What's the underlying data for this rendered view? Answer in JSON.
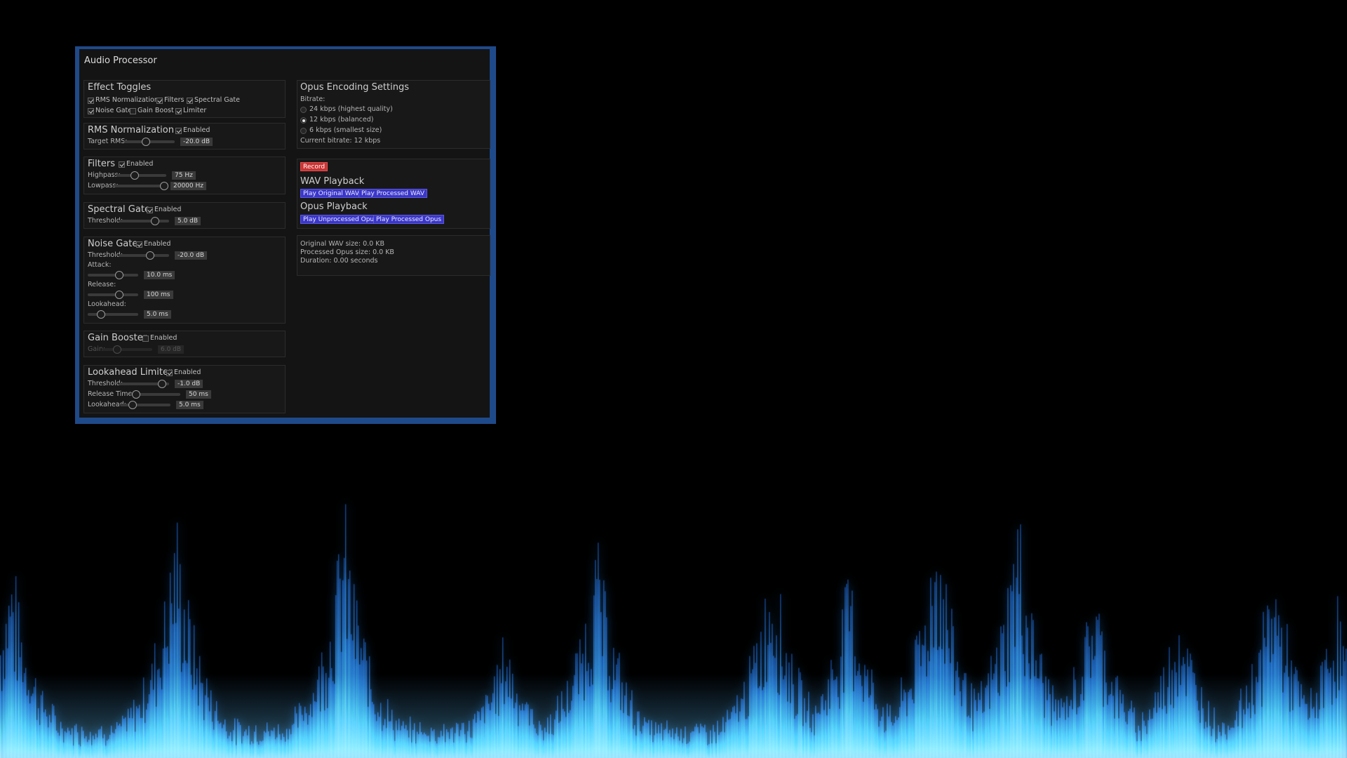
{
  "window": {
    "title": "Audio Processor"
  },
  "effect_toggles": {
    "title": "Effect Toggles",
    "items": [
      {
        "label": "RMS Normalization",
        "checked": true
      },
      {
        "label": "Filters",
        "checked": true
      },
      {
        "label": "Spectral Gate",
        "checked": true
      },
      {
        "label": "Noise Gate",
        "checked": true
      },
      {
        "label": "Gain Boost",
        "checked": false
      },
      {
        "label": "Limiter",
        "checked": true
      }
    ]
  },
  "rms": {
    "title": "RMS Normalization",
    "enabled_label": "Enabled",
    "enabled": true,
    "target_label": "Target RMS:",
    "target_value": "-20.0 dB",
    "target_fraction": 0.43
  },
  "filters": {
    "title": "Filters",
    "enabled_label": "Enabled",
    "enabled": true,
    "highpass_label": "Highpass:",
    "highpass_value": "75 Hz",
    "highpass_fraction": 0.38,
    "lowpass_label": "Lowpass:",
    "lowpass_value": "20000 Hz",
    "lowpass_fraction": 0.98
  },
  "spectral_gate": {
    "title": "Spectral Gate",
    "enabled_label": "Enabled",
    "enabled": true,
    "threshold_label": "Threshold:",
    "threshold_value": "5.0 dB",
    "threshold_fraction": 0.72
  },
  "noise_gate": {
    "title": "Noise Gate",
    "enabled_label": "Enabled",
    "enabled": true,
    "threshold_label": "Threshold:",
    "threshold_value": "-20.0 dB",
    "threshold_fraction": 0.63,
    "attack_label": "Attack:",
    "attack_value": "10.0 ms",
    "attack_fraction": 0.63,
    "release_label": "Release:",
    "release_value": "100 ms",
    "release_fraction": 0.63,
    "lookahead_label": "Lookahead:",
    "lookahead_value": "5.0 ms",
    "lookahead_fraction": 0.27
  },
  "gain_booster": {
    "title": "Gain Booster",
    "enabled_label": "Enabled",
    "enabled": false,
    "gain_label": "Gain:",
    "gain_value": "6.0 dB",
    "gain_fraction": 0.3
  },
  "limiter": {
    "title": "Lookahead Limiter",
    "enabled_label": "Enabled",
    "enabled": true,
    "threshold_label": "Threshold:",
    "threshold_value": "-1.0 dB",
    "threshold_fraction": 0.86,
    "release_label": "Release Time:",
    "release_value": "50 ms",
    "release_fraction": 0.12,
    "lookahead_label": "Lookahead:",
    "lookahead_value": "5.0 ms",
    "lookahead_fraction": 0.25
  },
  "opus": {
    "title": "Opus Encoding Settings",
    "bitrate_label": "Bitrate:",
    "options": [
      {
        "label": "24 kbps (highest quality)",
        "selected": false
      },
      {
        "label": "12 kbps (balanced)",
        "selected": true
      },
      {
        "label": "6 kbps (smallest size)",
        "selected": false
      }
    ],
    "current": "Current bitrate: 12 kbps"
  },
  "playback": {
    "record_label": "Record",
    "wav_title": "WAV Playback",
    "play_original_wav": "Play Original WAV",
    "play_processed_wav": "Play Processed WAV",
    "opus_title": "Opus Playback",
    "play_unprocessed_opus": "Play Unprocessed Opus",
    "play_processed_opus": "Play Processed Opus"
  },
  "info": {
    "wav_size": "Original WAV size: 0.0 KB",
    "opus_size": "Processed Opus size: 0.0 KB",
    "duration": "Duration: 0.00 seconds"
  },
  "colors": {
    "window_border": "#1f4a8a",
    "button": "#3b37c8",
    "record": "#cc3333",
    "spectrum": "#3fa9ff"
  }
}
